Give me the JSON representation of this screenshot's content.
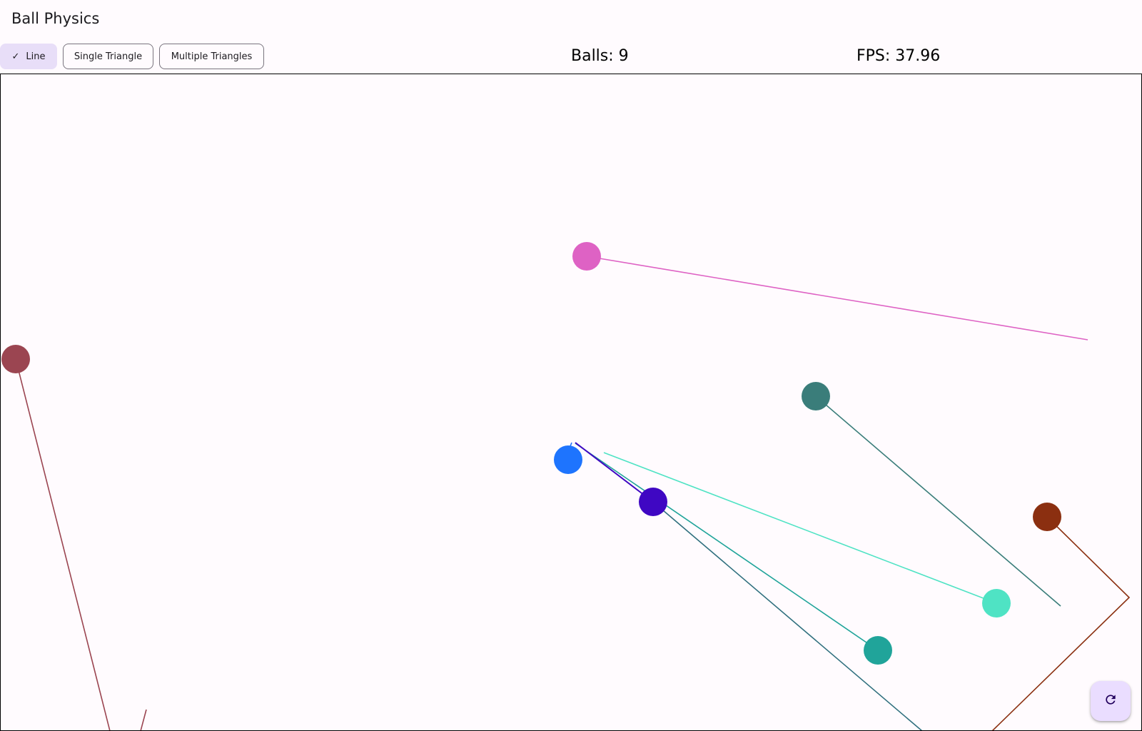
{
  "app": {
    "title": "Ball Physics"
  },
  "toolbar": {
    "chips": [
      {
        "label": "Line",
        "selected": true
      },
      {
        "label": "Single Triangle",
        "selected": false
      },
      {
        "label": "Multiple Triangles",
        "selected": false
      }
    ]
  },
  "stats": {
    "balls": "Balls: 9",
    "fps": "FPS: 37.96"
  },
  "balls": [
    {
      "name": "pink-ball",
      "color": "#de62c4"
    },
    {
      "name": "maroon-ball",
      "color": "#9b4551"
    },
    {
      "name": "slate-teal-ball",
      "color": "#3a7d7a"
    },
    {
      "name": "blue-ball",
      "color": "#1e74fe"
    },
    {
      "name": "indigo-ball",
      "color": "#3f07c3"
    },
    {
      "name": "brown-ball",
      "color": "#8b2f10"
    },
    {
      "name": "aqua-ball",
      "color": "#4fe3c4"
    },
    {
      "name": "teal-ball",
      "color": "#20a49a"
    },
    {
      "name": "hidden-ball",
      "color": "#2f6f7e"
    }
  ],
  "fab": {
    "icon": "refresh-icon",
    "color": "#eaddff"
  }
}
